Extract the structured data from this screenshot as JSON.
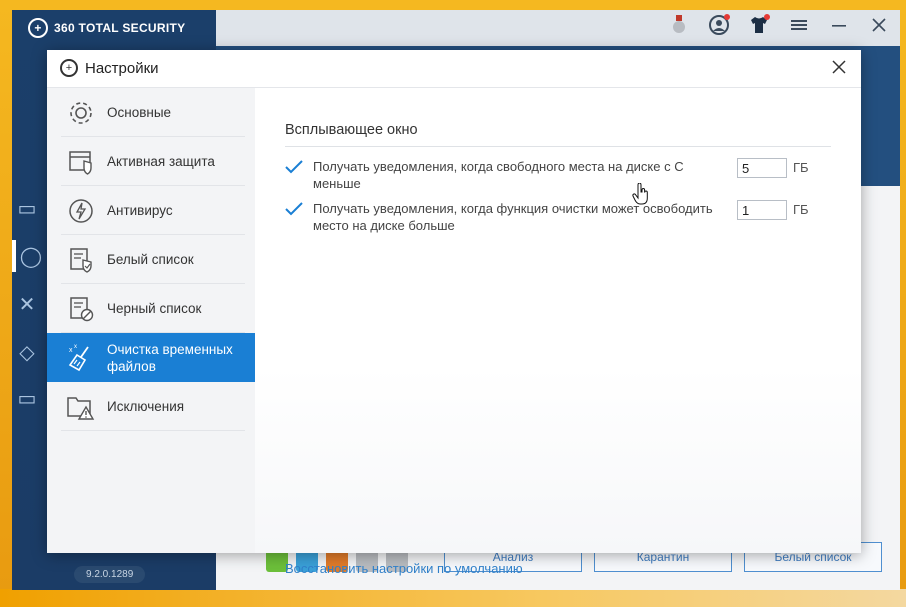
{
  "app": {
    "brand": "360 TOTAL SECURITY",
    "version": "9.2.0.1289",
    "bottom_buttons": [
      "Анализ",
      "Карантин",
      "Белый список"
    ]
  },
  "dialog": {
    "title": "Настройки",
    "nav": [
      {
        "label": "Основные",
        "icon": "gear-icon"
      },
      {
        "label": "Активная защита",
        "icon": "shield-window-icon"
      },
      {
        "label": "Антивирус",
        "icon": "lightning-icon"
      },
      {
        "label": "Белый список",
        "icon": "whitelist-icon"
      },
      {
        "label": "Черный список",
        "icon": "blacklist-icon"
      },
      {
        "label": "Очистка временных файлов",
        "icon": "broom-icon",
        "active": true
      },
      {
        "label": "Исключения",
        "icon": "folder-warning-icon"
      }
    ],
    "section_title": "Всплывающее окно",
    "options": [
      {
        "text": "Получать уведомления, когда свободного места на диске с C меньше",
        "value": "5",
        "unit": "ГБ",
        "checked": true
      },
      {
        "text": "Получать уведомления, когда функция очистки может освободить место на диске больше",
        "value": "1",
        "unit": "ГБ",
        "checked": true
      }
    ],
    "reset_link": "Восстановить настройки по умолчанию"
  },
  "colors": {
    "accent": "#1a7fd4",
    "link": "#2f7fc8",
    "app_sidebar": "#1b3f6a"
  }
}
